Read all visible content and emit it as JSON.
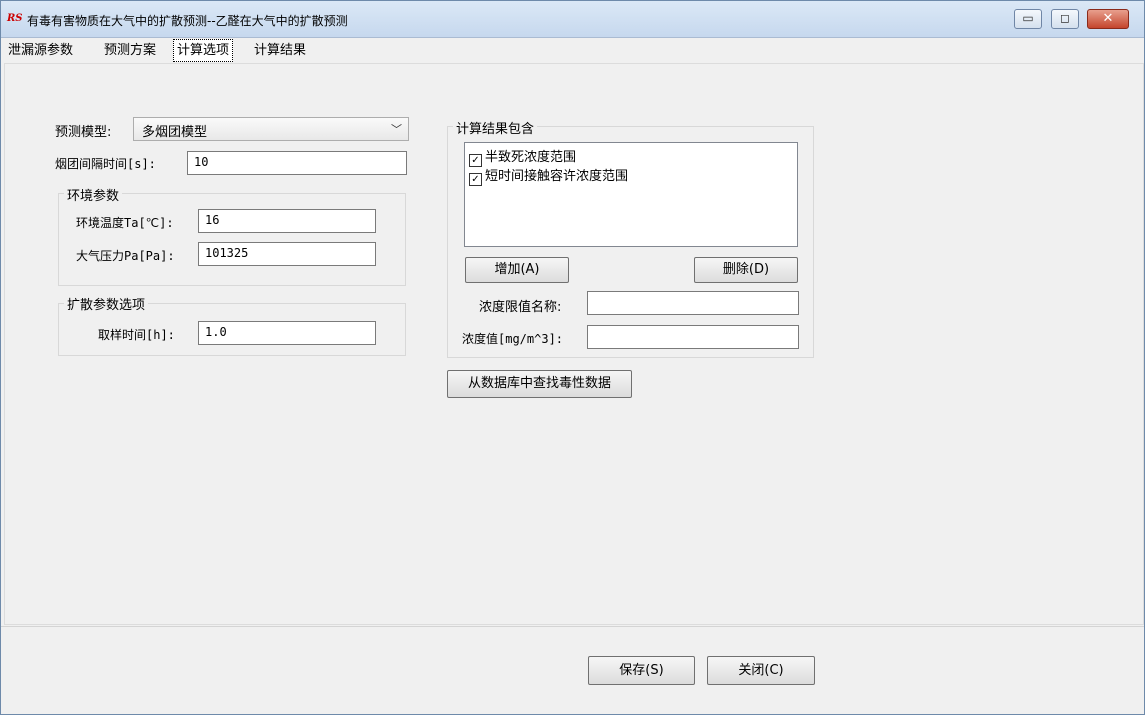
{
  "window": {
    "title": "有毒有害物质在大气中的扩散预测--乙醛在大气中的扩散预测",
    "min_glyph": "▭",
    "max_glyph": "◻",
    "close_glyph": "✕"
  },
  "tabs": [
    {
      "label": "泄漏源参数"
    },
    {
      "label": "预测方案"
    },
    {
      "label": "计算选项"
    },
    {
      "label": "计算结果"
    }
  ],
  "form": {
    "model_label": "预测模型:",
    "model_value": "多烟团模型",
    "interval_label": "烟团间隔时间[s]:",
    "interval_value": "10",
    "env_group_title": "环境参数",
    "temp_label": "环境温度Ta[℃]:",
    "temp_value": "16",
    "pressure_label": "大气压力Pa[Pa]:",
    "pressure_value": "101325",
    "diff_group_title": "扩散参数选项",
    "sample_label": "取样时间[h]:",
    "sample_value": "1.0"
  },
  "results": {
    "group_title": "计算结果包含",
    "items": [
      {
        "label": "半致死浓度范围",
        "checked": true
      },
      {
        "label": "短时间接触容许浓度范围",
        "checked": true
      }
    ],
    "add_label": "增加(A)",
    "delete_label": "删除(D)",
    "limit_name_label": "浓度限值名称:",
    "limit_name_value": "",
    "conc_label": "浓度值[mg/m^3]:",
    "conc_value": "",
    "lookup_label": "从数据库中查找毒性数据"
  },
  "footer": {
    "save_label": "保存(S)",
    "close_label": "关闭(C)"
  },
  "icons": {
    "app": "RS",
    "check": "✓",
    "chevron": "﹀"
  }
}
